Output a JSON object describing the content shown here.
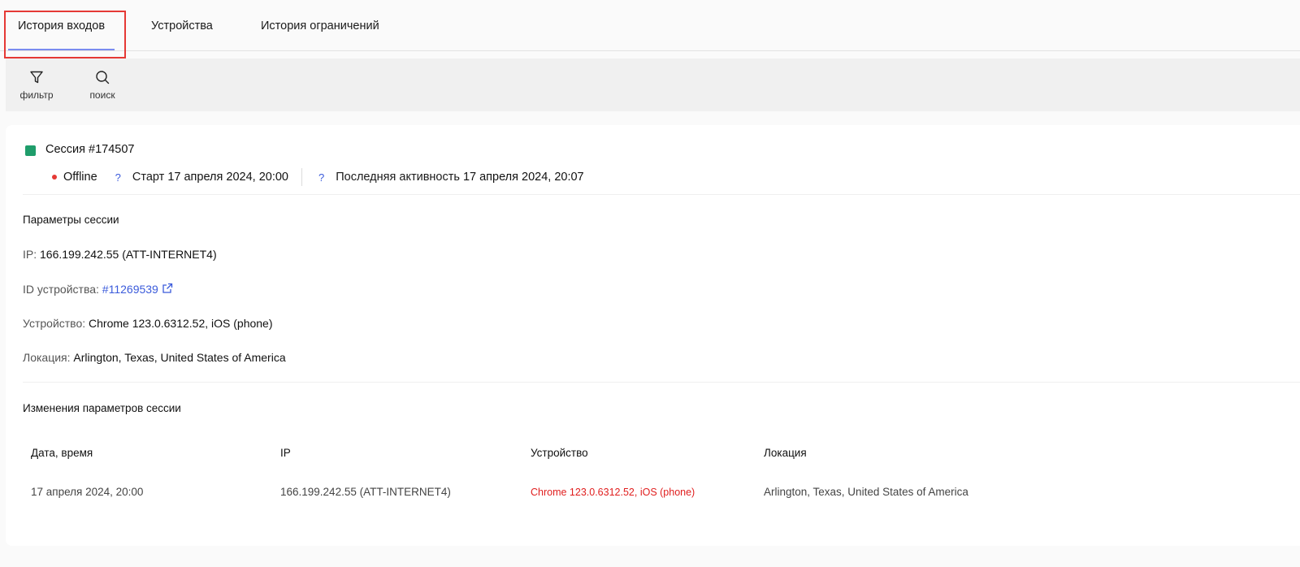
{
  "tabs": [
    {
      "label": "История входов",
      "active": true
    },
    {
      "label": "Устройства",
      "active": false
    },
    {
      "label": "История ограничений",
      "active": false
    }
  ],
  "toolbar": {
    "filter_label": "фильтр",
    "search_label": "поиск"
  },
  "session": {
    "title": "Сессия #174507",
    "status": "Offline",
    "start_label": "Старт",
    "start_value": "17 апреля 2024, 20:00",
    "last_activity_label": "Последняя активность",
    "last_activity_value": "17 апреля 2024, 20:07",
    "help_glyph": "?"
  },
  "params": {
    "title": "Параметры сессии",
    "ip_label": "IP:",
    "ip_value": "166.199.242.55 (ATT-INTERNET4)",
    "device_id_label": "ID устройства:",
    "device_id_value": "#11269539",
    "device_label": "Устройство:",
    "device_value": "Chrome 123.0.6312.52, iOS (phone)",
    "location_label": "Локация:",
    "location_value": "Arlington, Texas, United States of America"
  },
  "changes": {
    "title": "Изменения параметров сессии",
    "columns": [
      "Дата, время",
      "IP",
      "Устройство",
      "Локация"
    ],
    "rows": [
      [
        "17 апреля 2024, 20:00",
        "166.199.242.55 (ATT-INTERNET4)",
        "Chrome 123.0.6312.52, iOS (phone)",
        "Arlington, Texas, United States of America"
      ]
    ]
  },
  "colors": {
    "status_square": "#1f9d6b",
    "offline_dot": "#e53935",
    "link": "#3b5bdb",
    "changed_value": "#e01e1e",
    "active_tab_underline": "#7b8cf0",
    "highlight_box": "#e53935"
  }
}
